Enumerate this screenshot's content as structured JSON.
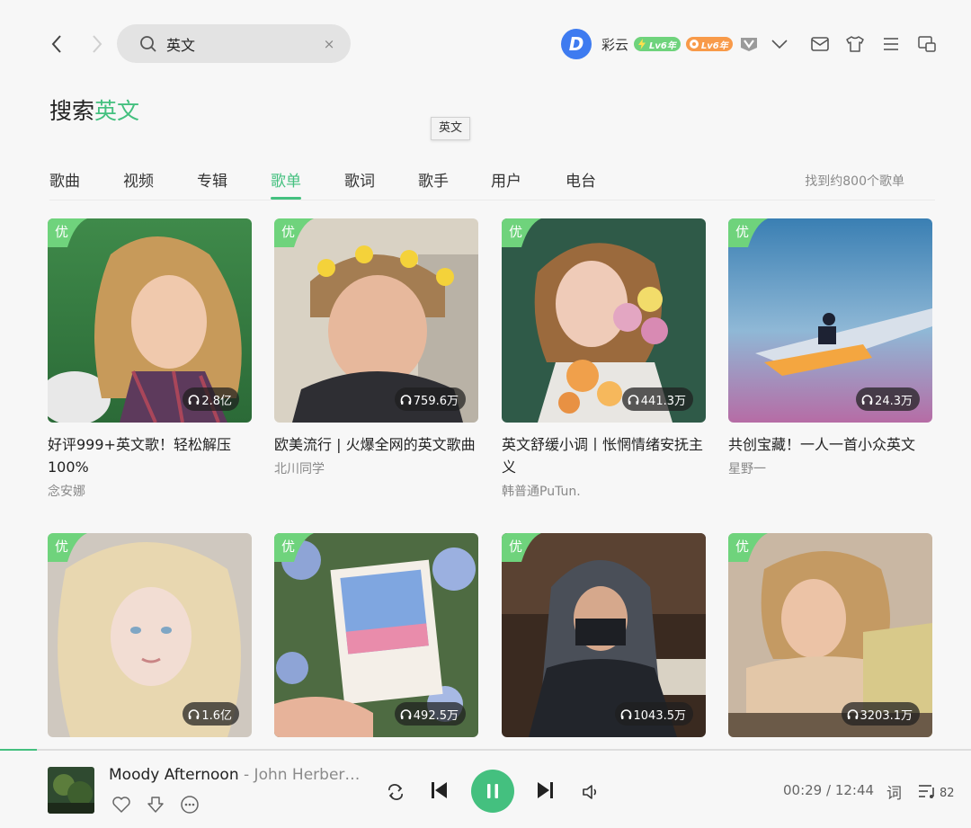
{
  "search": {
    "value": "英文",
    "clear_label": "×"
  },
  "user": {
    "avatar_letter": "D",
    "name": "彩云",
    "badge1": "Lv6年",
    "badge2": "Lv6年"
  },
  "title": {
    "prefix": "搜索",
    "keyword": "英文"
  },
  "tooltip": "英文",
  "tabs": [
    {
      "label": "歌曲"
    },
    {
      "label": "视频"
    },
    {
      "label": "专辑"
    },
    {
      "label": "歌单",
      "active": true
    },
    {
      "label": "歌词"
    },
    {
      "label": "歌手"
    },
    {
      "label": "用户"
    },
    {
      "label": "电台"
    }
  ],
  "result_count": "找到约800个歌单",
  "playlists": [
    {
      "tag": "优",
      "plays": "2.8亿",
      "title": "好评999+英文歌！轻松解压100%",
      "author": "念安娜"
    },
    {
      "tag": "优",
      "plays": "759.6万",
      "title": "欧美流行 | 火爆全网的英文歌曲",
      "author": "北川同学"
    },
    {
      "tag": "优",
      "plays": "441.3万",
      "title": "英文舒缓小调丨怅惘情绪安抚主义",
      "author": "韩普通PuTun."
    },
    {
      "tag": "优",
      "plays": "24.3万",
      "title": "共创宝藏！一人一首小众英文",
      "author": "星野一"
    },
    {
      "tag": "优",
      "plays": "1.6亿",
      "title": "",
      "author": ""
    },
    {
      "tag": "优",
      "plays": "492.5万",
      "title": "",
      "author": ""
    },
    {
      "tag": "优",
      "plays": "1043.5万",
      "title": "",
      "author": ""
    },
    {
      "tag": "优",
      "plays": "3203.1万",
      "title": "",
      "author": ""
    }
  ],
  "player": {
    "title": "Moody Afternoon",
    "artist": " - John Herber…",
    "time": "00:29 / 12:44",
    "lyric_label": "词",
    "queue_count": "82",
    "progress": 0.038
  },
  "colors": {
    "accent": "#44c07f",
    "avatar": "#3e7bf0"
  }
}
